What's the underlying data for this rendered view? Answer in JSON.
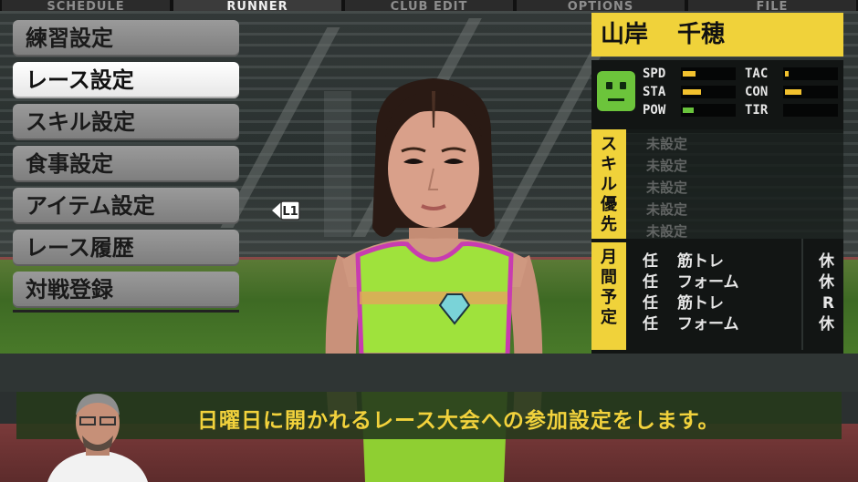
{
  "tabs": [
    {
      "label": "SCHEDULE",
      "active": false
    },
    {
      "label": "RUNNER",
      "active": true
    },
    {
      "label": "CLUB EDIT",
      "active": false
    },
    {
      "label": "OPTIONS",
      "active": false
    },
    {
      "label": "FILE",
      "active": false
    }
  ],
  "menu": [
    {
      "label": "練習設定",
      "selected": false
    },
    {
      "label": "レース設定",
      "selected": true
    },
    {
      "label": "スキル設定",
      "selected": false
    },
    {
      "label": "食事設定",
      "selected": false
    },
    {
      "label": "アイテム設定",
      "selected": false
    },
    {
      "label": "レース履歴",
      "selected": false
    },
    {
      "label": "対戦登録",
      "selected": false
    }
  ],
  "l1_label": "L1",
  "runner": {
    "last_name": "山岸",
    "first_name": "千穂"
  },
  "stats": [
    {
      "label": "SPD",
      "level": 0.25,
      "color": "#f2c12e"
    },
    {
      "label": "TAC",
      "level": 0.08,
      "color": "#f2c12e"
    },
    {
      "label": "STA",
      "level": 0.35,
      "color": "#f2c12e"
    },
    {
      "label": "CON",
      "level": 0.32,
      "color": "#f2c12e"
    },
    {
      "label": "POW",
      "level": 0.22,
      "color": "#69c33c"
    },
    {
      "label": "TIR",
      "level": 0,
      "color": "#f2c12e"
    }
  ],
  "skill_priority": {
    "label": "スキル優先",
    "items": [
      "未設定",
      "未設定",
      "未設定",
      "未設定",
      "未設定"
    ]
  },
  "monthly_schedule": {
    "label": "月間予定",
    "rows": [
      {
        "assign": "任",
        "activity": "筋トレ",
        "rest": "休"
      },
      {
        "assign": "任",
        "activity": "フォーム",
        "rest": "休"
      },
      {
        "assign": "任",
        "activity": "筋トレ",
        "rest": "R"
      },
      {
        "assign": "任",
        "activity": "フォーム",
        "rest": "休"
      }
    ]
  },
  "message": "日曜日に開かれるレース大会への参加設定をします。",
  "colors": {
    "accent_yellow": "#f0d23a",
    "message_yellow": "#f2d23c",
    "tank_top": "#9fe23c"
  }
}
